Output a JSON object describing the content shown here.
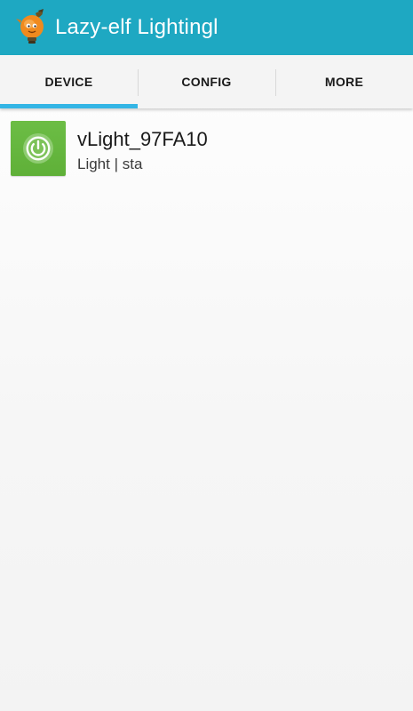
{
  "app": {
    "title": "Lazy-elf Lightingl",
    "logo_icon": "elf-lightbulb-icon",
    "bar_color": "#1ea8c2"
  },
  "tabs": [
    {
      "label": "DEVICE",
      "active": true
    },
    {
      "label": "CONFIG",
      "active": false
    },
    {
      "label": "MORE",
      "active": false
    }
  ],
  "tab_indicator_color": "#33b5e5",
  "devices": [
    {
      "name": "vLight_97FA10",
      "type": "Light",
      "mode": "sta",
      "subtitle": "Light | sta",
      "icon": "power-icon",
      "icon_color": "#64b43c"
    }
  ]
}
